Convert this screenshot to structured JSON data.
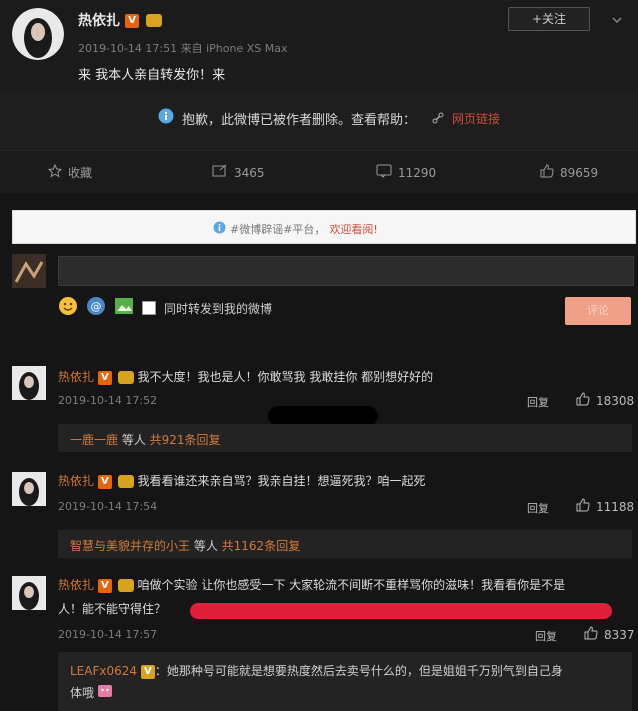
{
  "post": {
    "author": "热依扎",
    "time_source": "2019-10-14 17:51 来自 iPhone XS Max",
    "content": "来 我本人亲自转发你！来",
    "follow_label": "+关注"
  },
  "deleted": {
    "message": "抱歉，此微博已被作者删除。查看帮助：",
    "link_label": "网页链接"
  },
  "actions": {
    "favorite": "收藏",
    "repost": "3465",
    "comment": "11290",
    "like": "89659"
  },
  "notice": {
    "prefix": "#微博辟谣#平台，",
    "welcome": "欢迎看阅!"
  },
  "composer": {
    "repost_checkbox_label": "同时转发到我的微博",
    "submit_label": "评论"
  },
  "comments": [
    {
      "author": "热依扎",
      "text": "我不大度！我也是人！你敢骂我 我敢挂你 都别想好好的",
      "time": "2019-10-14 17:52",
      "reply_label": "回复",
      "likes": "18308",
      "strip_user": "一鹿一鹿",
      "strip_mid": " 等人 ",
      "strip_count": "共921条回复"
    },
    {
      "author": "热依扎",
      "text": "我看看谁还来亲自骂？我亲自挂！想逼死我？咱一起死",
      "time": "2019-10-14 17:54",
      "reply_label": "回复",
      "likes": "11188",
      "strip_user": "智慧与美貌并存的小王",
      "strip_mid": " 等人 ",
      "strip_count": "共1162条回复"
    },
    {
      "author": "热依扎",
      "text_line1": "咱做个实验 让你也感受一下 大家轮流不间断不重样骂你的滋味！我看看你是不是",
      "text_line2": "人！能不能守得住？",
      "time": "2019-10-14 17:57",
      "reply_label": "回复",
      "likes": "8337"
    }
  ],
  "last_reply": {
    "user": "LEAFx0624",
    "text_line1": "：她那种号可能就是想要热度然后去卖号什么的，但是姐姐千万别气到自己身",
    "text_line2": "体哦"
  },
  "colors": {
    "accent_orange": "#e8640c",
    "link_red": "#d24a3a",
    "redaction_red": "#e0203a"
  }
}
